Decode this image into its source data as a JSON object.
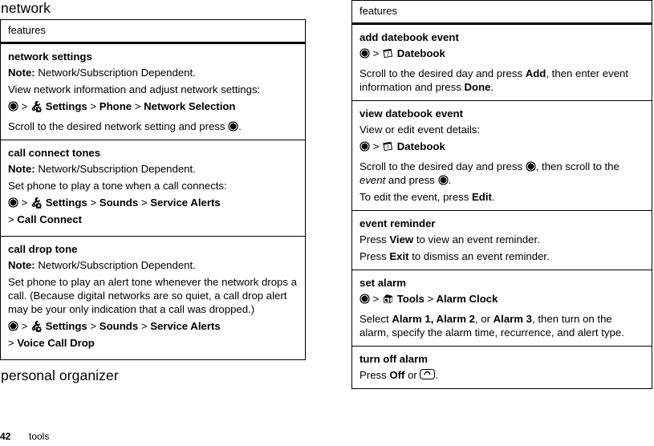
{
  "page": {
    "number": "42",
    "section_label": "tools"
  },
  "left_column": {
    "chapter_heading": "network",
    "table": {
      "header": "features",
      "rows": [
        {
          "title": "network settings",
          "note_label": "Note:",
          "note_text": " Network/Subscription Dependent.",
          "body": "View network information and adjust network settings:",
          "path": {
            "icon_start": "center-select-key-icon",
            "icon_menu": "settings-gear-icon",
            "items": [
              "Settings",
              "Phone",
              "Network Selection"
            ],
            "separator": ">"
          },
          "footer_text_before": "Scroll to the desired network setting and press ",
          "footer_icon": "center-select-key-icon",
          "footer_text_after": "."
        },
        {
          "title": "call connect tones",
          "note_label": "Note:",
          "note_text": " Network/Subscription Dependent.",
          "body": "Set phone to play a tone when a call connects:",
          "path": {
            "icon_start": "center-select-key-icon",
            "icon_menu": "settings-gear-icon",
            "items": [
              "Settings",
              "Sounds",
              "Service Alerts"
            ],
            "continuation": "Call Connect",
            "separator": ">"
          }
        },
        {
          "title": "call drop tone",
          "note_label": "Note:",
          "note_text": " Network/Subscription Dependent.",
          "body": "Set phone to play an alert tone whenever the network drops a call. (Because digital networks are so quiet, a call drop alert may be your only indication that a call was dropped.)",
          "path": {
            "icon_start": "center-select-key-icon",
            "icon_menu": "settings-gear-icon",
            "items": [
              "Settings",
              "Sounds",
              "Service Alerts"
            ],
            "continuation": "Voice Call Drop",
            "separator": ">"
          }
        }
      ]
    },
    "chapter_heading_2": "personal organizer"
  },
  "right_column": {
    "table": {
      "header": "features",
      "rows": [
        {
          "title": "add datebook event",
          "path": {
            "icon_start": "center-select-key-icon",
            "icon_menu": "datebook-calendar-icon",
            "items": [
              "Datebook"
            ],
            "separator": ">"
          },
          "body_parts": [
            {
              "text": "Scroll to the desired day and press ",
              "bold": false
            },
            {
              "text": "Add",
              "bold": true
            },
            {
              "text": ", then enter event information and press ",
              "bold": false
            },
            {
              "text": "Done",
              "bold": true
            },
            {
              "text": ".",
              "bold": false
            }
          ]
        },
        {
          "title": "view datebook event",
          "body": "View or edit event details:",
          "path": {
            "icon_start": "center-select-key-icon",
            "icon_menu": "datebook-calendar-icon",
            "items": [
              "Datebook"
            ],
            "separator": ">"
          },
          "instruction_1": {
            "t1": "Scroll to the desired day and press ",
            "icon1": "center-select-key-icon",
            "t2": ", then scroll to the ",
            "italic": "event",
            "t3": " and press ",
            "icon2": "center-select-key-icon",
            "t4": "."
          },
          "instruction_2_parts": [
            {
              "text": "To edit the event, press ",
              "bold": false
            },
            {
              "text": "Edit",
              "bold": true
            },
            {
              "text": ".",
              "bold": false
            }
          ]
        },
        {
          "title": "event reminder",
          "line_1_parts": [
            {
              "text": "Press ",
              "bold": false
            },
            {
              "text": "View",
              "bold": true
            },
            {
              "text": " to view an event reminder.",
              "bold": false
            }
          ],
          "line_2_parts": [
            {
              "text": "Press ",
              "bold": false
            },
            {
              "text": "Exit",
              "bold": true
            },
            {
              "text": " to dismiss an event reminder.",
              "bold": false
            }
          ]
        },
        {
          "title": "set alarm",
          "path": {
            "icon_start": "center-select-key-icon",
            "icon_menu": "tools-icon",
            "items": [
              "Tools",
              "Alarm Clock"
            ],
            "separator": ">"
          },
          "body_parts": [
            {
              "text": "Select ",
              "bold": false
            },
            {
              "text": "Alarm 1, Alarm 2",
              "bold": true
            },
            {
              "text": ", or ",
              "bold": false
            },
            {
              "text": "Alarm 3",
              "bold": true
            },
            {
              "text": ", then turn on the alarm, specify the alarm time, recurrence, and alert type.",
              "bold": false
            }
          ]
        },
        {
          "title": "turn off alarm",
          "line_parts": [
            {
              "text": "Press ",
              "bold": false
            },
            {
              "text": "Off",
              "bold": true
            },
            {
              "text": " or ",
              "bold": false
            }
          ],
          "end_icon": "end-call-key-icon",
          "line_end": "."
        }
      ]
    }
  },
  "colors": {
    "ink": "#000000",
    "paper": "#ffffff"
  }
}
